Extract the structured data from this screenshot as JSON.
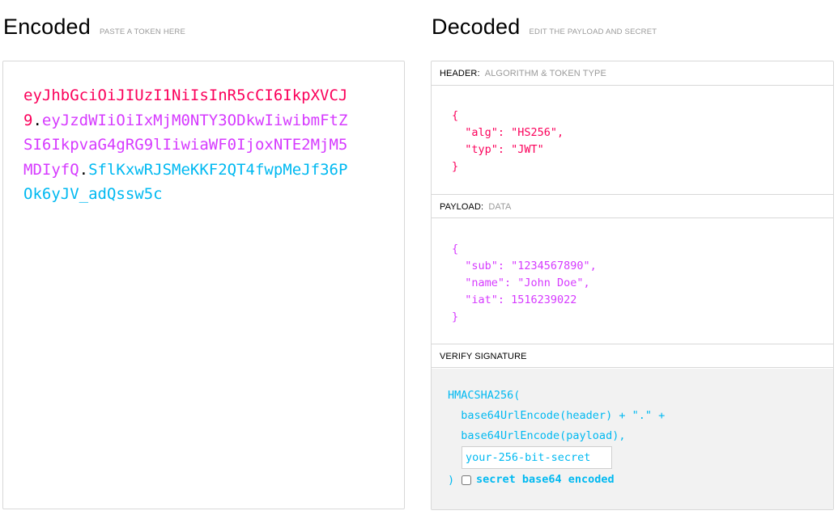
{
  "encoded": {
    "title": "Encoded",
    "subtitle": "PASTE A TOKEN HERE",
    "token_header": "eyJhbGciOiJIUzI1NiIsInR5cCI6IkpXVCJ9",
    "dot1": ".",
    "token_payload": "eyJzdWIiOiIxMjM0NTY3ODkwIiwibmFtZSI6IkpvaG4gRG9lIiwiaWF0IjoxNTE2MjM5MDIyfQ",
    "dot2": ".",
    "token_signature": "SflKxwRJSMeKKF2QT4fwpMeJf36POk6yJV_adQssw5c"
  },
  "decoded": {
    "title": "Decoded",
    "subtitle": "EDIT THE PAYLOAD AND SECRET",
    "header_section": {
      "label": "HEADER:",
      "sublabel": "ALGORITHM & TOKEN TYPE",
      "json": "{\n  \"alg\": \"HS256\",\n  \"typ\": \"JWT\"\n}"
    },
    "payload_section": {
      "label": "PAYLOAD:",
      "sublabel": "DATA",
      "json": "{\n  \"sub\": \"1234567890\",\n  \"name\": \"John Doe\",\n  \"iat\": 1516239022\n}"
    },
    "verify_section": {
      "label": "VERIFY SIGNATURE",
      "line1": "HMACSHA256(",
      "line2": "  base64UrlEncode(header) + \".\" +",
      "line3": "  base64UrlEncode(payload),",
      "secret_placeholder": "your-256-bit-secret",
      "close_paren": ")",
      "checkbox_label": "secret base64 encoded"
    }
  },
  "colors": {
    "header": "#fb015b",
    "payload": "#d63aff",
    "signature": "#00b9f1"
  }
}
